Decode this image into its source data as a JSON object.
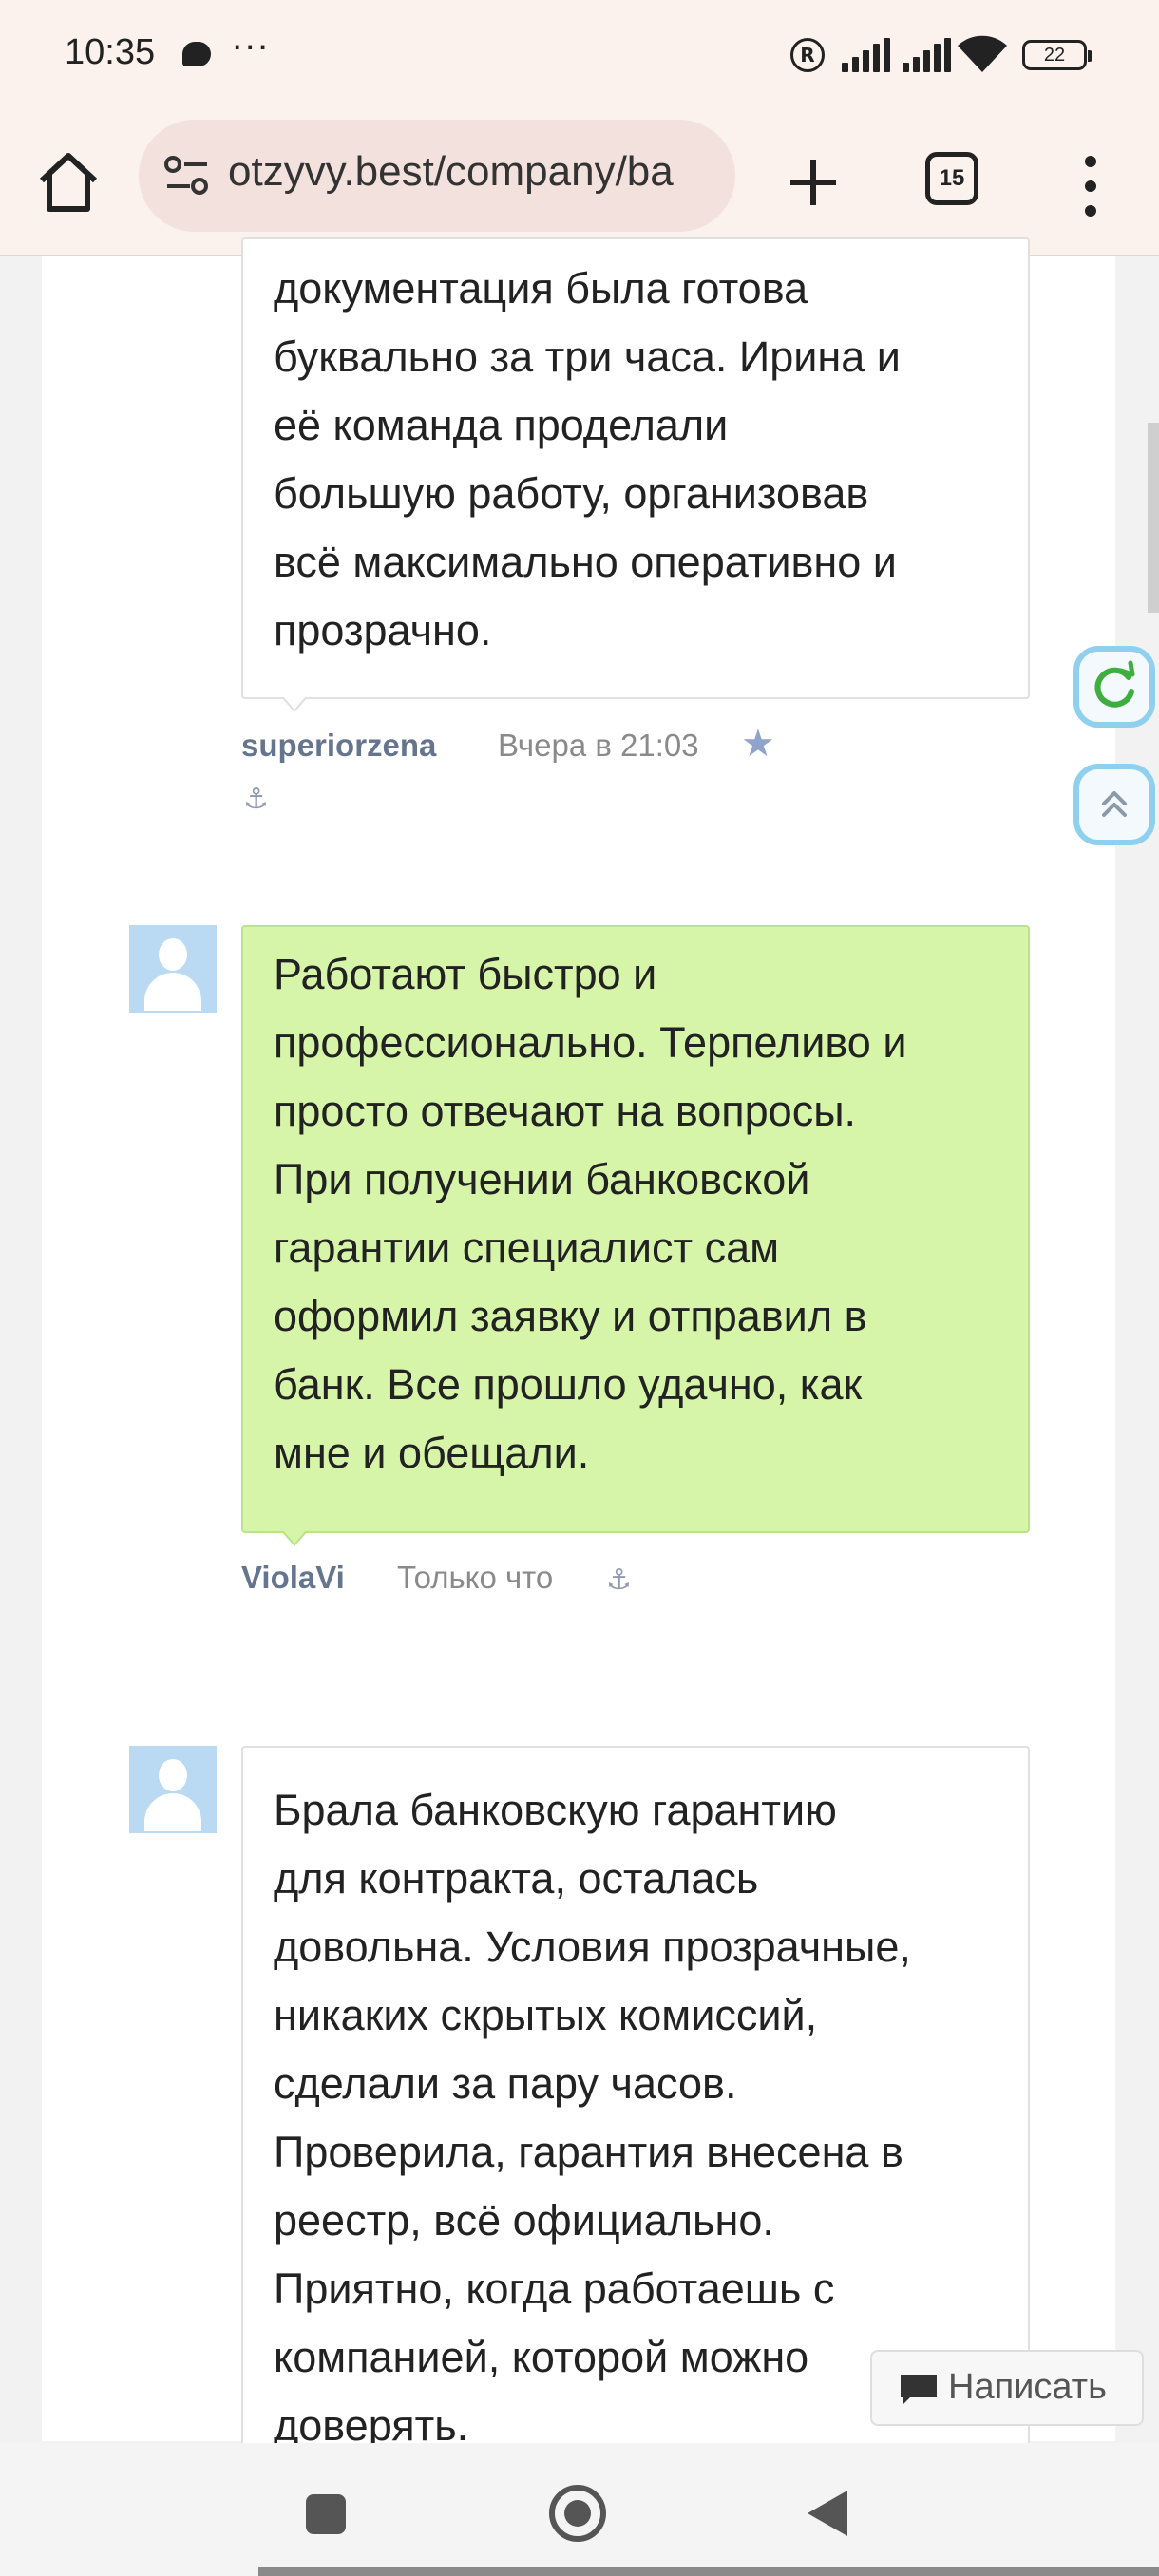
{
  "status_bar": {
    "time": "10:35",
    "dots": "···",
    "battery": "22"
  },
  "browser": {
    "url": "otzyvy.best/company/ba",
    "tab_count": "15"
  },
  "reviews": [
    {
      "text_lines": [
        "документация была готова",
        "буквально за три часа. Ирина и",
        "её команда проделали",
        "большую работу, организовав",
        "всё максимально оперативно и",
        "прозрачно."
      ],
      "author": "superiorzena",
      "date": "Вчера в 21:03"
    },
    {
      "text_lines": [
        "Работают быстро и",
        "профессионально. Терпеливо и",
        "просто отвечают на вопросы.",
        "При получении банковской",
        "гарантии специалист сам",
        "оформил заявку и отправил в",
        "банк. Все прошло удачно, как",
        "мне и обещали."
      ],
      "author": "ViolaVi",
      "date": "Только что"
    },
    {
      "text_lines": [
        "Брала банковскую гарантию",
        "для контракта, осталась",
        "довольна. Условия прозрачные,",
        "никаких скрытых комиссий,",
        "сделали за пару часов.",
        "Проверила, гарантия внесена в",
        "реестр, всё официально.",
        "Приятно, когда работаешь с",
        "компанией, которой можно",
        "доверять."
      ]
    }
  ],
  "write_button": {
    "label": "Написать"
  },
  "icons": {
    "anchor": "⚓",
    "star": "★",
    "refresh": "refresh-icon",
    "scroll_top": "double-chevron-up-icon"
  },
  "colors": {
    "highlight_bubble": "#d6f5a9",
    "author": "#66758f",
    "float_border": "#8fd0ef"
  }
}
